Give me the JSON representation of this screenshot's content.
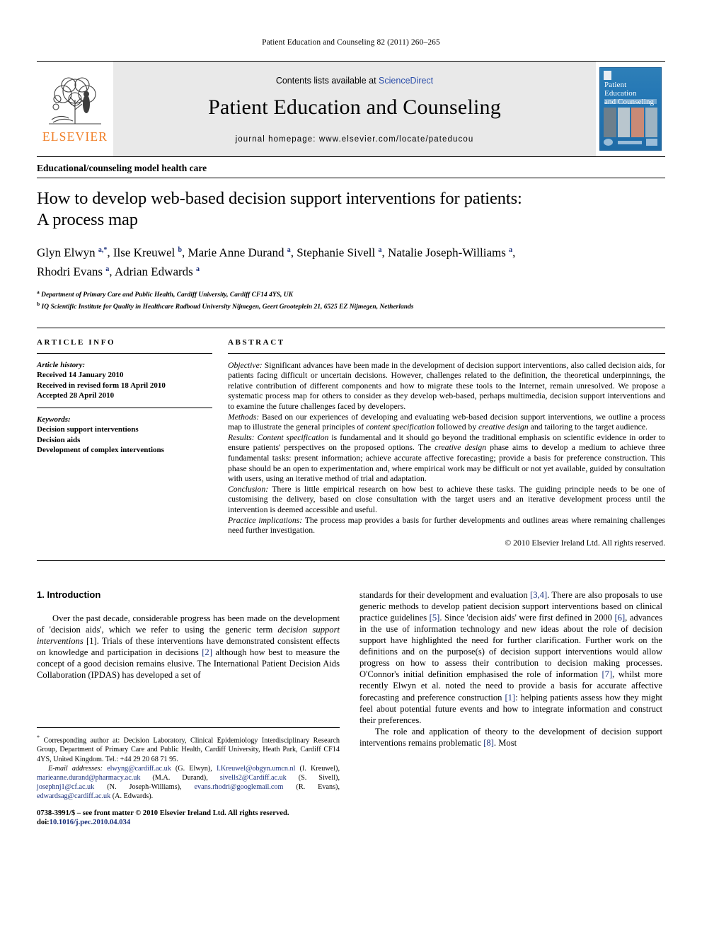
{
  "running_head": "Patient Education and Counseling 82 (2011) 260–265",
  "masthead": {
    "publisher_logo_text": "ELSEVIER",
    "contents_prefix": "Contents lists available at",
    "contents_link": "ScienceDirect",
    "journal_title": "Patient Education and Counseling",
    "homepage": "journal homepage: www.elsevier.com/locate/pateducou",
    "cover": {
      "title_line1": "Patient Education",
      "title_line2": "and Counseling"
    }
  },
  "section_heading": "Educational/counseling model health care",
  "article": {
    "title_line1": "How to develop web-based decision support interventions for patients:",
    "title_line2": "A process map",
    "authors_line1": "Glyn Elwyn a,*, Ilse Kreuwel b, Marie Anne Durand a, Stephanie Sivell a, Natalie Joseph-Williams a,",
    "authors_line2": "Rhodri Evans a, Adrian Edwards a",
    "affiliation_a": "Department of Primary Care and Public Health, Cardiff University, Cardiff CF14 4YS, UK",
    "affiliation_b": "IQ Scientific Institute for Quality in Healthcare Radboud University Nijmegen, Geert Grooteplein 21, 6525 EZ Nijmegen, Netherlands"
  },
  "article_info": {
    "label": "ARTICLE INFO",
    "history_label": "Article history:",
    "history": [
      "Received 14 January 2010",
      "Received in revised form 18 April 2010",
      "Accepted 28 April 2010"
    ],
    "keywords_label": "Keywords:",
    "keywords": [
      "Decision support interventions",
      "Decision aids",
      "Development of complex interventions"
    ]
  },
  "abstract": {
    "label": "ABSTRACT",
    "objective_label": "Objective:",
    "objective_text": " Significant advances have been made in the development of decision support interventions, also called decision aids, for patients facing difficult or uncertain decisions. However, challenges related to the definition, the theoretical underpinnings, the relative contribution of different components and how to migrate these tools to the Internet, remain unresolved. We propose a systematic process map for others to consider as they develop web-based, perhaps multimedia, decision support interventions and to examine the future challenges faced by developers.",
    "methods_label": "Methods:",
    "methods_text_1": " Based on our experiences of developing and evaluating web-based decision support interventions, we outline a process map to illustrate the general principles of ",
    "methods_em_1": "content specification",
    "methods_text_2": " followed by ",
    "methods_em_2": "creative design",
    "methods_text_3": " and tailoring to the target audience.",
    "results_label": "Results:",
    "results_em_1": " Content specification",
    "results_text_1": " is fundamental and it should go beyond the traditional emphasis on scientific evidence in order to ensure patients' perspectives on the proposed options. The ",
    "results_em_2": "creative design",
    "results_text_2": " phase aims to develop a medium to achieve three fundamental tasks: present information; achieve accurate affective forecasting; provide a basis for preference construction. This phase should be an open to experimentation and, where empirical work may be difficult or not yet available, guided by consultation with users, using an iterative method of trial and adaptation.",
    "conclusion_label": "Conclusion:",
    "conclusion_text": " There is little empirical research on how best to achieve these tasks. The guiding principle needs to be one of customising the delivery, based on close consultation with the target users and an iterative development process until the intervention is deemed accessible and useful.",
    "practice_label": "Practice implications:",
    "practice_text": " The process map provides a basis for further developments and outlines areas where remaining challenges need further investigation.",
    "copyright": "© 2010 Elsevier Ireland Ltd. All rights reserved."
  },
  "body": {
    "intro_heading": "1. Introduction",
    "left_para_1_a": "Over the past decade, considerable progress has been made on the development of 'decision aids', which we refer to using the generic term ",
    "left_para_1_em": "decision support interventions",
    "left_para_1_b": " [1]. Trials of these interventions have demonstrated consistent effects on knowledge and participation in decisions ",
    "left_para_1_ref2": "[2]",
    "left_para_1_c": " although how best to measure the concept of a good decision remains elusive. The International Patient Decision Aids Collaboration (IPDAS) has developed a set of",
    "right_para_1_a": "standards for their development and evaluation ",
    "right_para_1_ref34": "[3,4]",
    "right_para_1_b": ". There are also proposals to use generic methods to develop patient decision support interventions based on clinical practice guidelines ",
    "right_para_1_ref5": "[5]",
    "right_para_1_c": ". Since 'decision aids' were first defined in 2000 ",
    "right_para_1_ref6": "[6]",
    "right_para_1_d": ", advances in the use of information technology and new ideas about the role of decision support have highlighted the need for further clarification. Further work on the definitions and on the purpose(s) of decision support interventions would allow progress on how to assess their contribution to decision making processes. O'Connor's initial definition emphasised the role of information ",
    "right_para_1_ref7": "[7]",
    "right_para_1_e": ", whilst more recently Elwyn et al. noted the need to provide a basis for accurate affective forecasting and preference construction ",
    "right_para_1_ref1": "[1]",
    "right_para_1_f": ": helping patients assess how they might feel about potential future events and how to integrate information and construct their preferences.",
    "right_para_2_a": "The role and application of theory to the development of decision support interventions remains problematic ",
    "right_para_2_ref8": "[8]",
    "right_para_2_b": ". Most"
  },
  "footnote": {
    "corresponding": "Corresponding author at: Decision Laboratory, Clinical Epidemiology Interdisciplinary Research Group, Department of Primary Care and Public Health, Cardiff University, Heath Park, Cardiff CF14 4YS, United Kingdom. Tel.: +44 29 20 68 71 95.",
    "email_label": "E-mail addresses:",
    "emails": [
      {
        "address": "elwyng@cardiff.ac.uk",
        "name": " (G. Elwyn), "
      },
      {
        "address": "I.Kreuwel@obgyn.umcn.nl",
        "name": " (I. Kreuwel), "
      },
      {
        "address": "marieanne.durand@pharmacy.ac.uk",
        "name": " (M.A. Durand), "
      },
      {
        "address": "sivells2@Cardiff.ac.uk",
        "name": " (S. Sivell), "
      },
      {
        "address": "josephnj1@cf.ac.uk",
        "name": " (N. Joseph-Williams), "
      },
      {
        "address": "evans.rhodri@googlemail.com",
        "name": " (R. Evans), "
      },
      {
        "address": "edwardsag@cardiff.ac.uk",
        "name": " (A. Edwards)."
      }
    ]
  },
  "imprint": {
    "line1": "0738-3991/$ – see front matter © 2010 Elsevier Ireland Ltd. All rights reserved.",
    "doi_label": "doi:",
    "doi_value": "10.1016/j.pec.2010.04.034"
  },
  "colors": {
    "elsevier_orange": "#f07e26",
    "link_blue": "#2b4eaa",
    "reference_blue": "#1a2f7a",
    "banner_gray": "#e9e9e9"
  }
}
